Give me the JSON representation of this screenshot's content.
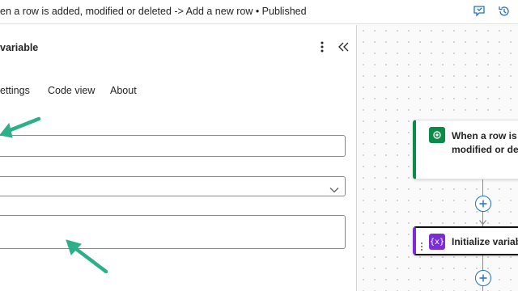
{
  "header": {
    "flow_title": "en a row is added, modified or deleted -> Add a new row • Published",
    "icons": [
      "feedback-icon",
      "history-icon"
    ]
  },
  "panel": {
    "title": "variable",
    "icons": [
      "more-options-icon",
      "collapse-panel-icon"
    ],
    "tabs": [
      {
        "label": "ettings"
      },
      {
        "label": "Code view"
      },
      {
        "label": "About"
      }
    ],
    "fields": {
      "name_value": "",
      "type_value": "",
      "value_value": ""
    }
  },
  "canvas": {
    "trigger_card": {
      "line1": "When a row is a",
      "line2": "modified or dele",
      "icon": "dataverse-icon",
      "accent": "#0b8a4a"
    },
    "action_card": {
      "label": "Initialize variab",
      "icon": "variable-icon",
      "icon_text": "{x}",
      "accent": "#7b2fd1"
    },
    "add_icon": "plus-circle-icon"
  },
  "annotations": {
    "arrow_color": "#2bb08a"
  },
  "colors": {
    "link_blue": "#1f6fd1",
    "border": "#8a8a8a"
  }
}
